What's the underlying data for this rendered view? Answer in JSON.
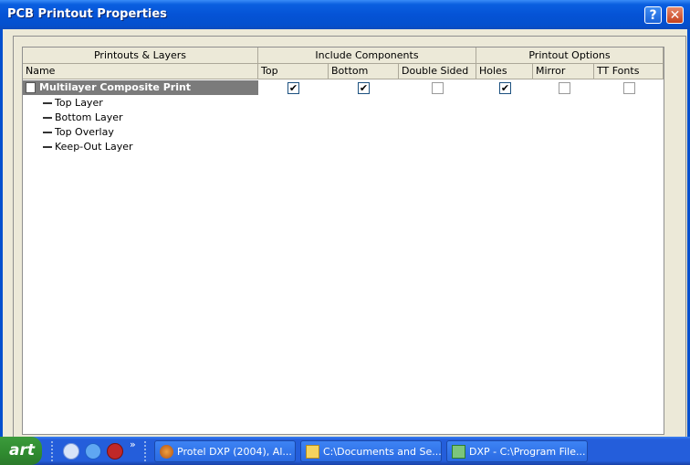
{
  "window": {
    "title": "PCB Printout Properties",
    "help_btn": "?",
    "close_btn": "✕"
  },
  "table": {
    "groups": [
      "Printouts & Layers",
      "Include Components",
      "Printout Options"
    ],
    "columns": [
      "Name",
      "Top",
      "Bottom",
      "Double Sided",
      "Holes",
      "Mirror",
      "TT Fonts"
    ],
    "main_row": {
      "name": "Multilayer Composite Print",
      "top": true,
      "bottom": true,
      "double_sided": false,
      "holes": true,
      "mirror": false,
      "tt_fonts": false
    },
    "layers": [
      "Top Layer",
      "Bottom Layer",
      "Top Overlay",
      "Keep-Out Layer"
    ]
  },
  "taskbar": {
    "start": "art",
    "overflow": "»",
    "tasks": [
      {
        "label": "Protel DXP (2004), Al..."
      },
      {
        "label": "C:\\Documents and Se..."
      },
      {
        "label": "DXP - C:\\Program File..."
      }
    ]
  }
}
